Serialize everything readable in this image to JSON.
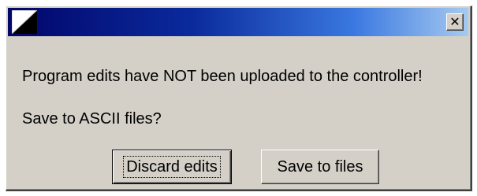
{
  "dialog": {
    "close_glyph": "✕",
    "message_line1": "Program edits have NOT been uploaded to the controller!",
    "message_line2": "Save to ASCII files?",
    "buttons": {
      "discard_label": "Discard edits",
      "save_label": "Save to files"
    }
  },
  "icons": {
    "app": "app-icon",
    "close": "close-icon"
  },
  "colors": {
    "titlebar_start": "#02066a",
    "titlebar_end": "#a6caf0",
    "face": "#d4d0c8"
  }
}
